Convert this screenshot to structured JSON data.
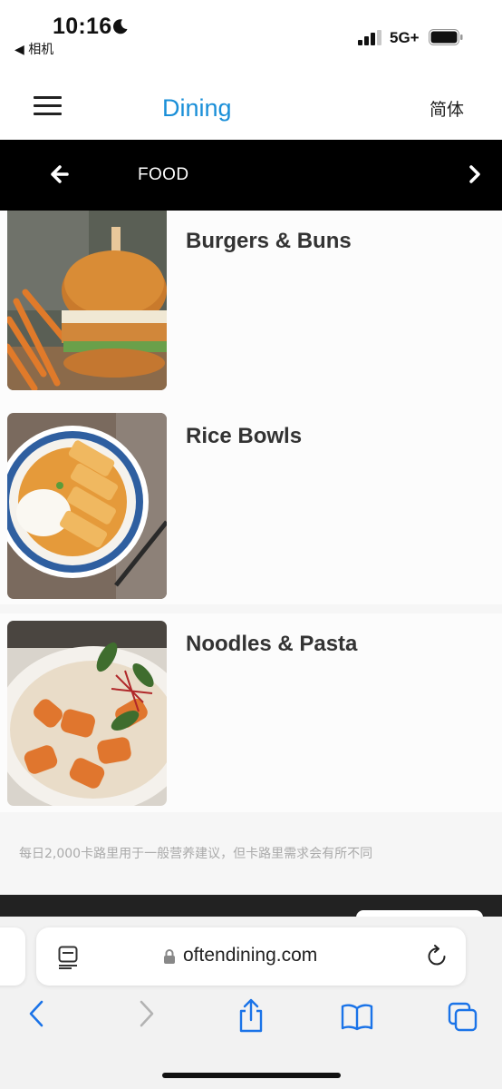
{
  "status_bar": {
    "time": "10:16",
    "back_app": "◀ 相机",
    "network": "5G+"
  },
  "header": {
    "title": "Dining",
    "language": "简体"
  },
  "category": {
    "title": "FOOD"
  },
  "food_items": [
    {
      "name": "Burgers & Buns"
    },
    {
      "name": "Rice Bowls"
    },
    {
      "name": "Noodles & Pasta"
    }
  ],
  "disclaimer": "每日2,000卡路里用于一般营养建议，但卡路里需求会有所不同",
  "browser": {
    "url": "oftendining.com"
  },
  "colors": {
    "accent": "#1a8fd8",
    "category_bar": "#000000",
    "safari_blue": "#1a73e8"
  },
  "icons": {
    "menu": "hamburger-menu-icon",
    "prev": "arrow-left-icon",
    "next": "chevron-right-icon",
    "reader": "reader-icon",
    "lock": "lock-icon",
    "reload": "reload-icon",
    "back": "back-chevron-icon",
    "forward": "forward-chevron-icon",
    "share": "share-icon",
    "bookmarks": "bookmarks-icon",
    "tabs": "tabs-icon"
  }
}
